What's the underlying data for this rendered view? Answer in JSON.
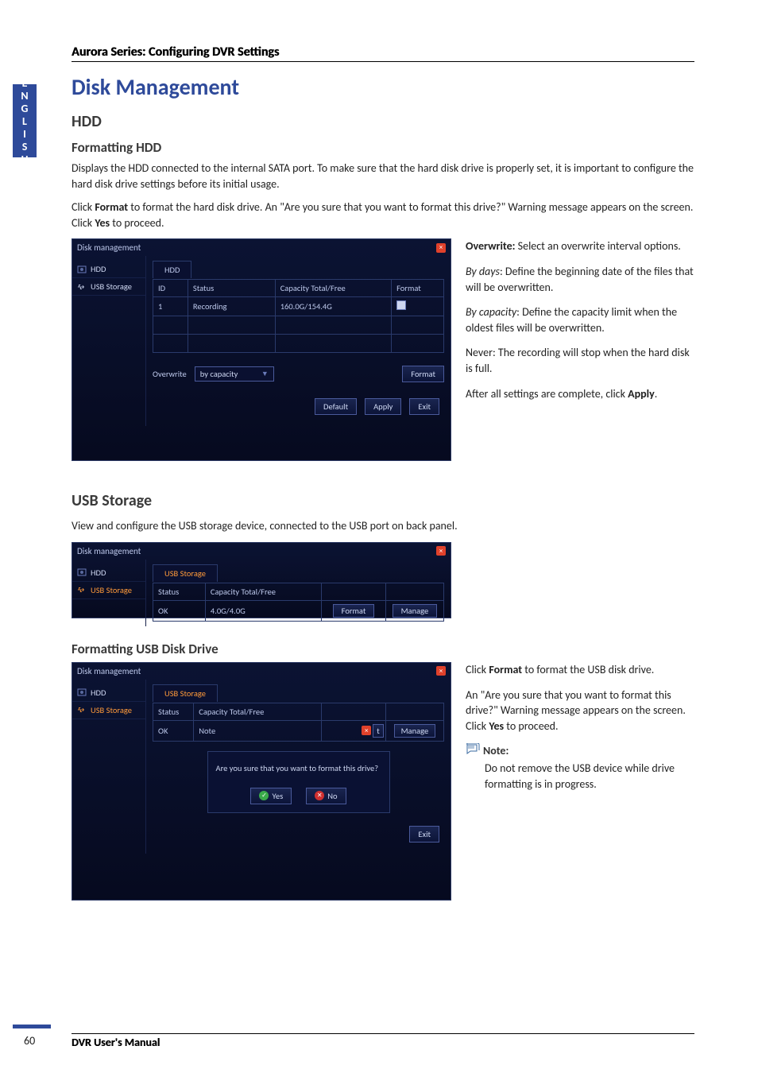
{
  "lang_tab": "ENGLISH",
  "header": "Aurora Series: Configuring DVR Settings",
  "title": "Disk Management",
  "hdd": {
    "heading": "HDD",
    "sub": "Formatting HDD",
    "p1a": "Displays the HDD connected to the internal SATA port. To make sure that the hard disk drive is properly set, it is important to configure the hard disk drive settings before its initial usage.",
    "p2_pre": "Click ",
    "p2_b1": "Format",
    "p2_mid": " to format the hard disk drive. An \"Are you sure that you want to format this drive?\" Warning message appears on the screen. Click ",
    "p2_b2": "Yes",
    "p2_post": " to proceed."
  },
  "hdd_window": {
    "title": "Disk management",
    "sidebar": {
      "hdd": "HDD",
      "usb": "USB Storage"
    },
    "tab": "HDD",
    "cols": {
      "id": "ID",
      "status": "Status",
      "capacity": "Capacity Total/Free",
      "format": "Format"
    },
    "row": {
      "id": "1",
      "status": "Recording",
      "capacity": "160.0G/154.4G"
    },
    "overwrite_label": "Overwrite",
    "overwrite_value": "by capacity",
    "btn_format": "Format",
    "btn_default": "Default",
    "btn_apply": "Apply",
    "btn_exit": "Exit"
  },
  "hdd_side": {
    "ow_label": "Overwrite:",
    "ow_text": " Select an overwrite interval options.",
    "bydays_i": "By days",
    "bydays_t": ": Define the beginning date of the files that will be overwritten.",
    "bycap_i": "By capacity",
    "bycap_t": ": Define the capacity limit when the oldest files will be overwritten.",
    "never": "Never: The recording will stop when the hard disk is full.",
    "apply_pre": "After all settings are complete, click ",
    "apply_b": "Apply",
    "apply_post": "."
  },
  "usb": {
    "heading": "USB Storage",
    "desc": "View and configure the USB storage device, connected to the USB port on back panel."
  },
  "usb_window": {
    "title": "Disk management",
    "tab": "USB Storage",
    "sidebar": {
      "hdd": "HDD",
      "usb": "USB Storage"
    },
    "cols": {
      "status": "Status",
      "capacity": "Capacity Total/Free"
    },
    "row": {
      "status": "OK",
      "capacity": "4.0G/4.0G"
    },
    "btn_format": "Format",
    "btn_manage": "Manage"
  },
  "usb_fmt": {
    "heading": "Formatting USB Disk Drive"
  },
  "usb_fmt_window": {
    "title": "Disk management",
    "tab": "USB Storage",
    "sidebar": {
      "hdd": "HDD",
      "usb": "USB Storage"
    },
    "cols": {
      "status": "Status",
      "capacity": "Capacity Total/Free"
    },
    "row": {
      "status": "OK",
      "capacity": "Note"
    },
    "btn_t": "t",
    "btn_manage": "Manage",
    "dialog": "Are you sure that you want to format this drive?",
    "yes": "Yes",
    "no": "No",
    "btn_exit": "Exit"
  },
  "usb_side": {
    "p1_pre": "Click ",
    "p1_b": "Format",
    "p1_post": " to format the USB disk drive.",
    "p2_pre": "An \"Are you sure that you want to format this drive?\" Warning message appears on the screen. Click ",
    "p2_b": "Yes",
    "p2_post": " to proceed.",
    "note_label": "Note:",
    "note_text": "Do not remove the USB device while drive formatting is in progress."
  },
  "footer": "DVR User's Manual",
  "page_number": "60"
}
